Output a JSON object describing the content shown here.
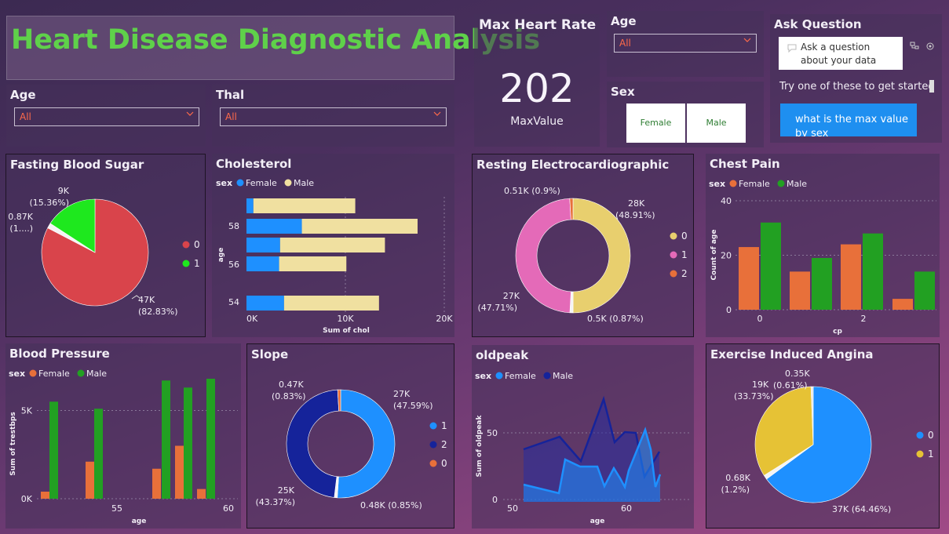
{
  "title": "Heart Disease Diagnostic Analysis",
  "filters": {
    "age_left": {
      "label": "Age",
      "value": "All"
    },
    "thal": {
      "label": "Thal",
      "value": "All"
    },
    "age_right": {
      "label": "Age",
      "value": "All"
    },
    "sex": {
      "label": "Sex",
      "options": [
        "Female",
        "Male"
      ]
    }
  },
  "kpi": {
    "title": "Max Heart Rate",
    "value": "202",
    "caption": "MaxValue"
  },
  "ask": {
    "title": "Ask Question",
    "placeholder": "Ask a question about your data",
    "hint": "Try one of these to get started",
    "suggestion": "what is the max value by sex"
  },
  "colors": {
    "female_blue": "#1e90ff",
    "male_yellow": "#f0e0a0",
    "orange": "#e8703a",
    "green": "#22a022",
    "navy": "#15239a"
  },
  "chart_data": [
    {
      "id": "fbs",
      "type": "pie",
      "title": "Fasting Blood Sugar",
      "slices": [
        {
          "name": "0",
          "value": 47000,
          "label": "47K",
          "pct": "(82.83%)",
          "color": "#d9444b"
        },
        {
          "name": "1",
          "value": 9000,
          "label": "9K",
          "pct": "(15.36%)",
          "color": "#1ee81e"
        },
        {
          "name": "",
          "value": 870,
          "label": "0.87K",
          "pct": "(1....)",
          "color": "#f4f4f4"
        }
      ],
      "legend": [
        "0",
        "1"
      ]
    },
    {
      "id": "chol",
      "type": "bar",
      "title": "Cholesterol",
      "legend_title": "sex",
      "series_names": [
        "Female",
        "Male"
      ],
      "categories": [
        "",
        "58",
        "",
        "56",
        "",
        "54"
      ],
      "female": [
        700,
        5600,
        3400,
        3300,
        0,
        3800
      ],
      "male": [
        10300,
        11700,
        10600,
        6800,
        0,
        9600
      ],
      "ytick_labels": [
        "58",
        "56",
        "54"
      ],
      "xticks": [
        "0K",
        "10K",
        "20K"
      ],
      "xlabel": "Sum of chol",
      "ylabel": "age"
    },
    {
      "id": "restecg",
      "type": "pie",
      "title": "Resting Electrocardiographic",
      "slices": [
        {
          "name": "0",
          "value": 28000,
          "label": "28K",
          "pct": "(48.91%)",
          "color": "#e8cf6e"
        },
        {
          "name": "1",
          "value": 27000,
          "label": "27K",
          "pct": "(47.71%)",
          "color": "#e46ab8"
        },
        {
          "name": "2",
          "value": 510,
          "label": "0.51K (0.9%)",
          "pct": "",
          "color": "#e8703a"
        },
        {
          "name": "",
          "value": 500,
          "label": "0.5K (0.87%)",
          "pct": "",
          "color": "#f4f4f4"
        }
      ],
      "legend": [
        "0",
        "1",
        "2"
      ]
    },
    {
      "id": "cp",
      "type": "bar",
      "title": "Chest Pain",
      "legend_title": "sex",
      "series_names": [
        "Female",
        "Male"
      ],
      "categories": [
        "0",
        "1",
        "2",
        "3"
      ],
      "female": [
        23,
        14,
        24,
        4
      ],
      "male": [
        32,
        19,
        28,
        14
      ],
      "yticks": [
        "0",
        "20",
        "40"
      ],
      "xtick_labels": [
        "0",
        "2"
      ],
      "xlabel": "cp",
      "ylabel": "Count of age"
    },
    {
      "id": "bp",
      "type": "bar",
      "title": "Blood Pressure",
      "legend_title": "sex",
      "series_names": [
        "Female",
        "Male"
      ],
      "categories": [
        "52",
        "54",
        "57",
        "58",
        "59",
        "60"
      ],
      "female": [
        400,
        2100,
        0,
        1700,
        3000,
        550
      ],
      "male": [
        5500,
        5100,
        0,
        6700,
        6300,
        6800
      ],
      "male_only_extra": [],
      "yticks": [
        "0K",
        "5K"
      ],
      "xticks": [
        "55",
        "60"
      ],
      "xlabel": "age",
      "ylabel": "Sum of trestbps"
    },
    {
      "id": "slope",
      "type": "pie",
      "title": "Slope",
      "slices": [
        {
          "name": "1",
          "value": 27000,
          "label": "27K",
          "pct": "(47.59%)",
          "color": "#1e90ff"
        },
        {
          "name": "2",
          "value": 25000,
          "label": "25K",
          "pct": "(43.37%)",
          "color": "#15239a"
        },
        {
          "name": "0",
          "value": 470,
          "label": "0.47K",
          "pct": "(0.83%)",
          "color": "#e8703a"
        },
        {
          "name": "",
          "value": 480,
          "label": "0.48K (0.85%)",
          "pct": "",
          "color": "#f4f4f4"
        }
      ],
      "legend": [
        "1",
        "2",
        "0"
      ]
    },
    {
      "id": "oldpeak",
      "type": "area",
      "title": "oldpeak",
      "legend_title": "sex",
      "series_names": [
        "Female",
        "Male"
      ],
      "x": [
        50,
        52,
        54,
        55,
        56,
        57,
        58,
        59,
        60,
        61,
        62,
        63,
        64,
        65
      ],
      "female": [
        2,
        25,
        30,
        28,
        27,
        20,
        17,
        12,
        2,
        20,
        3,
        50,
        15,
        25
      ],
      "male": [
        38,
        42,
        52,
        48,
        27,
        28,
        60,
        75,
        52,
        30,
        30,
        52,
        15,
        35
      ],
      "yticks": [
        "0",
        "50"
      ],
      "xticks": [
        "50",
        "60"
      ],
      "xlabel": "age",
      "ylabel": "Sum of oldpeak"
    },
    {
      "id": "exang",
      "type": "pie",
      "title": "Exercise Induced Angina",
      "slices": [
        {
          "name": "0",
          "value": 37000,
          "label": "37K (64.46%)",
          "pct": "",
          "color": "#1e90ff"
        },
        {
          "name": "1",
          "value": 19000,
          "label": "19K",
          "pct": "(33.73%)",
          "color": "#e6c235"
        },
        {
          "name": "",
          "value": 680,
          "label": "0.68K",
          "pct": "(1.2%)",
          "color": "#f4f4f4"
        },
        {
          "name": "",
          "value": 350,
          "label": "0.35K",
          "pct": "(0.61%)",
          "color": "#e8e8e8"
        }
      ],
      "legend": [
        "0",
        "1"
      ]
    }
  ]
}
